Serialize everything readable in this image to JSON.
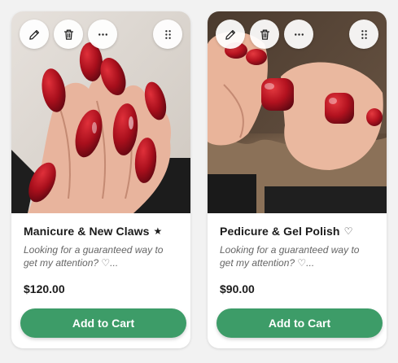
{
  "products": [
    {
      "title": "Manicure & New Claws",
      "badge": "★",
      "description_line1": "Looking for a guaranteed way to",
      "description_line2": "get my attention? ♡...",
      "price": "$120.00",
      "cta": "Add to Cart",
      "image_icon": "manicure-photo"
    },
    {
      "title": "Pedicure & Gel Polish",
      "badge": "♡",
      "description_line1": "Looking for a guaranteed way to",
      "description_line2": "get my attention? ♡...",
      "price": "$90.00",
      "cta": "Add to Cart",
      "image_icon": "pedicure-photo"
    }
  ],
  "toolbar_icons": [
    "edit-icon",
    "trash-icon",
    "more-icon",
    "drag-handle-icon"
  ],
  "colors": {
    "accent": "#3d9c68",
    "nail_red": "#b3121f",
    "card_bg": "#ffffff",
    "page_bg": "#f2f2f2"
  }
}
